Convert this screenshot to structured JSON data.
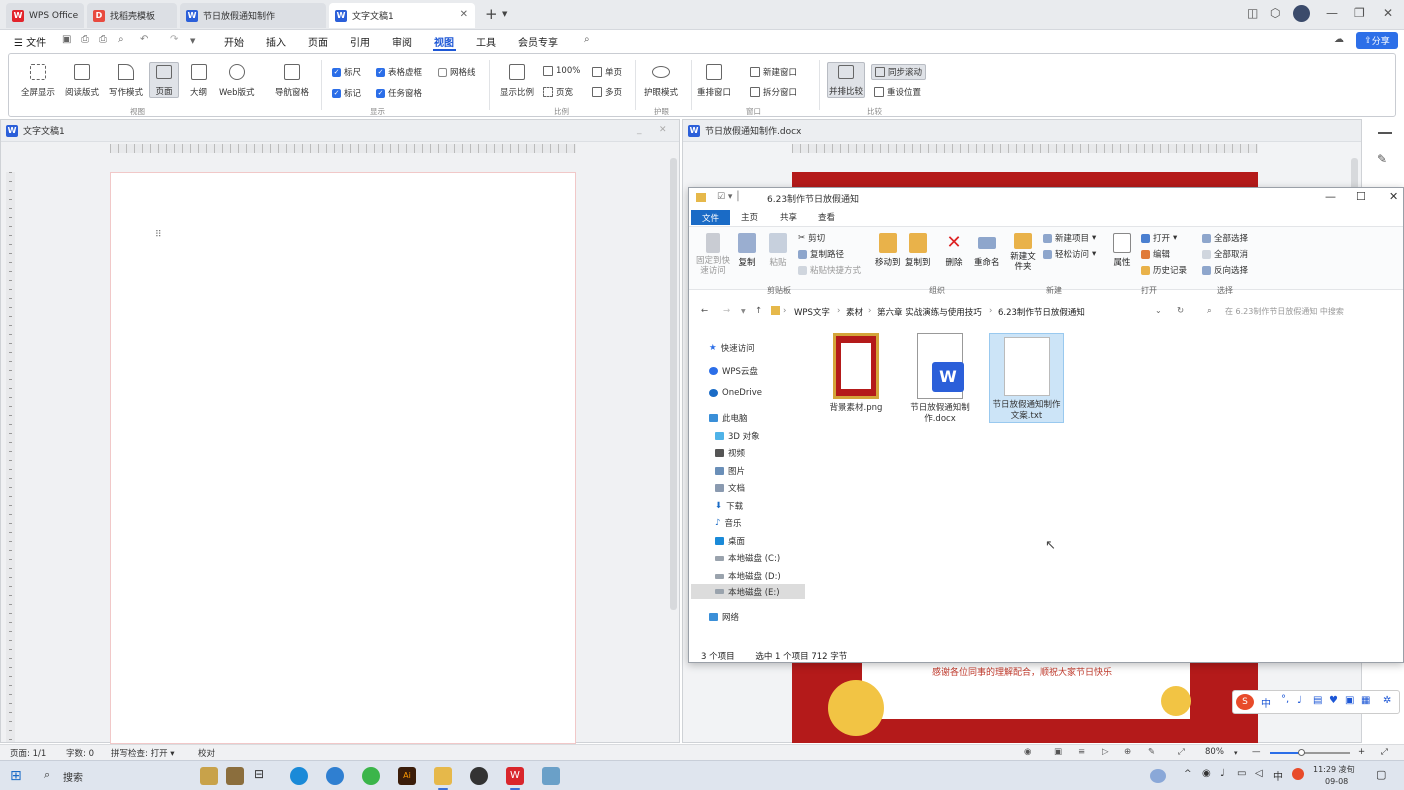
{
  "tabs": [
    {
      "label": "WPS Office",
      "icon": "wps-logo-icon"
    },
    {
      "label": "找稻壳模板",
      "icon": "docer-icon"
    },
    {
      "label": "节日放假通知制作",
      "icon": "word-doc-icon"
    },
    {
      "label": "文字文稿1",
      "icon": "word-doc-icon"
    }
  ],
  "menu": {
    "file": "文件",
    "items": [
      "开始",
      "插入",
      "页面",
      "引用",
      "审阅",
      "视图",
      "工具",
      "会员专享"
    ],
    "active": "视图",
    "share": "分享"
  },
  "ribbon": {
    "buttons": [
      "全屏显示",
      "阅读版式",
      "写作模式",
      "页面",
      "大纲",
      "Web版式",
      "导航窗格"
    ],
    "groups": [
      "视图",
      "显示",
      "比例",
      "护眼",
      "窗口",
      "比较"
    ],
    "checks": [
      {
        "label": "标尺",
        "checked": true
      },
      {
        "label": "表格虚框",
        "checked": true
      },
      {
        "label": "网格线",
        "checked": false
      },
      {
        "label": "标记",
        "checked": true
      },
      {
        "label": "任务窗格",
        "checked": true
      }
    ],
    "zoom": {
      "show_ratio": "显示比例",
      "pct100": "100%",
      "page_width": "页宽",
      "single": "单页",
      "multi": "多页"
    },
    "eye": "护眼模式",
    "window": {
      "rearrange": "重排窗口",
      "new_window": "新建窗口",
      "split": "拆分窗口"
    },
    "compare": {
      "side_by_side": "并排比较",
      "sync_scroll": "同步滚动",
      "reset_position": "重设位置"
    }
  },
  "left_doc": {
    "title": "文字文稿1"
  },
  "right_doc": {
    "title": "节日放假通知制作.docx",
    "body_text": "感谢各位同事的理解配合，顺祝大家节日快乐"
  },
  "explorer": {
    "title": "6.23制作节日放假通知",
    "tabs": [
      "文件",
      "主页",
      "共享",
      "查看"
    ],
    "ribbon": {
      "pin": "固定到快速访问",
      "copy": "复制",
      "paste": "粘贴",
      "cut": "剪切",
      "copy_path": "复制路径",
      "paste_shortcut": "粘贴快捷方式",
      "move_to": "移动到",
      "copy_to": "复制到",
      "delete": "删除",
      "rename": "重命名",
      "new_folder": "新建文件夹",
      "new_item": "新建项目",
      "easy_access": "轻松访问",
      "properties": "属性",
      "open": "打开",
      "edit": "编辑",
      "history": "历史记录",
      "select_all": "全部选择",
      "select_none": "全部取消",
      "invert": "反向选择",
      "groups": [
        "剪贴板",
        "组织",
        "新建",
        "打开",
        "选择"
      ]
    },
    "breadcrumb": [
      "WPS文字",
      "素材",
      "第六章 实战演练与使用技巧",
      "6.23制作节日放假通知"
    ],
    "search_placeholder": "在 6.23制作节日放假通知 中搜索",
    "nav": [
      "快速访问",
      "WPS云盘",
      "OneDrive",
      "此电脑",
      "3D 对象",
      "视频",
      "图片",
      "文档",
      "下载",
      "音乐",
      "桌面",
      "本地磁盘 (C:)",
      "本地磁盘 (D:)",
      "本地磁盘 (E:)",
      "网络"
    ],
    "nav_selected": "本地磁盘 (E:)",
    "files": [
      {
        "name": "背景素材.png",
        "type": "png"
      },
      {
        "name": "节日放假通知制作.docx",
        "type": "docx"
      },
      {
        "name": "节日放假通知制作文案.txt",
        "type": "txt",
        "selected": true
      }
    ],
    "status_count": "3 个项目",
    "status_selected": "选中 1 个项目  712 字节"
  },
  "statusbar": {
    "page": "页面: 1/1",
    "words": "字数: 0",
    "spell": "拼写检查: 打开",
    "proof": "校对",
    "zoom": "80%"
  },
  "taskbar": {
    "search": "搜索",
    "time": "11:29 凌旬",
    "date": "09-08",
    "ime": "中"
  },
  "ime_bar": "中",
  "colors": {
    "accent": "#1d57d6",
    "share": "#2d6fe8",
    "festive_red": "#b41a1a",
    "gold": "#f2c444"
  }
}
